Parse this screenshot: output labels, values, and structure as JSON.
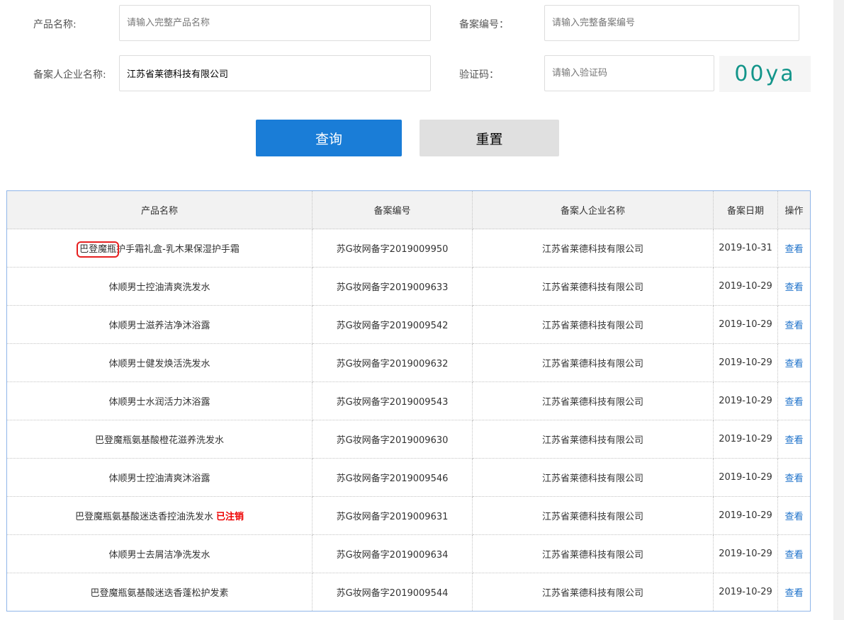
{
  "form": {
    "product_name_label": "产品名称:",
    "product_name_placeholder": "请输入完整产品名称",
    "record_no_label": "备案编号：",
    "record_no_placeholder": "请输入完整备案编号",
    "company_label": "备案人企业名称:",
    "company_value": "江苏省莱德科技有限公司",
    "captcha_label": "验证码：",
    "captcha_placeholder": "请输入验证码",
    "captcha_text": "00ya",
    "query_button": "查询",
    "reset_button": "重置"
  },
  "table": {
    "headers": [
      "产品名称",
      "备案编号",
      "备案人企业名称",
      "备案日期",
      "操作"
    ],
    "rows": [
      {
        "name_highlight": "巴登魔瓶",
        "name": "护手霜礼盒-乳木果保湿护手霜",
        "status": "",
        "no": "苏G妆网备字2019009950",
        "company": "江苏省莱德科技有限公司",
        "date": "2019-10-31",
        "action": "查看"
      },
      {
        "name_highlight": "",
        "name": "体顺男士控油清爽洗发水",
        "status": "",
        "no": "苏G妆网备字2019009633",
        "company": "江苏省莱德科技有限公司",
        "date": "2019-10-29",
        "action": "查看"
      },
      {
        "name_highlight": "",
        "name": "体顺男士滋养洁净沐浴露",
        "status": "",
        "no": "苏G妆网备字2019009542",
        "company": "江苏省莱德科技有限公司",
        "date": "2019-10-29",
        "action": "查看"
      },
      {
        "name_highlight": "",
        "name": "体顺男士健发焕活洗发水",
        "status": "",
        "no": "苏G妆网备字2019009632",
        "company": "江苏省莱德科技有限公司",
        "date": "2019-10-29",
        "action": "查看"
      },
      {
        "name_highlight": "",
        "name": "体顺男士水润活力沐浴露",
        "status": "",
        "no": "苏G妆网备字2019009543",
        "company": "江苏省莱德科技有限公司",
        "date": "2019-10-29",
        "action": "查看"
      },
      {
        "name_highlight": "",
        "name": "巴登魔瓶氨基酸橙花滋养洗发水",
        "status": "",
        "no": "苏G妆网备字2019009630",
        "company": "江苏省莱德科技有限公司",
        "date": "2019-10-29",
        "action": "查看"
      },
      {
        "name_highlight": "",
        "name": "体顺男士控油清爽沐浴露",
        "status": "",
        "no": "苏G妆网备字2019009546",
        "company": "江苏省莱德科技有限公司",
        "date": "2019-10-29",
        "action": "查看"
      },
      {
        "name_highlight": "",
        "name": "巴登魔瓶氨基酸迷迭香控油洗发水",
        "status": "已注销",
        "no": "苏G妆网备字2019009631",
        "company": "江苏省莱德科技有限公司",
        "date": "2019-10-29",
        "action": "查看"
      },
      {
        "name_highlight": "",
        "name": "体顺男士去屑洁净洗发水",
        "status": "",
        "no": "苏G妆网备字2019009634",
        "company": "江苏省莱德科技有限公司",
        "date": "2019-10-29",
        "action": "查看"
      },
      {
        "name_highlight": "",
        "name": "巴登魔瓶氨基酸迷迭香蓬松护发素",
        "status": "",
        "no": "苏G妆网备字2019009544",
        "company": "江苏省莱德科技有限公司",
        "date": "2019-10-29",
        "action": "查看"
      }
    ]
  }
}
